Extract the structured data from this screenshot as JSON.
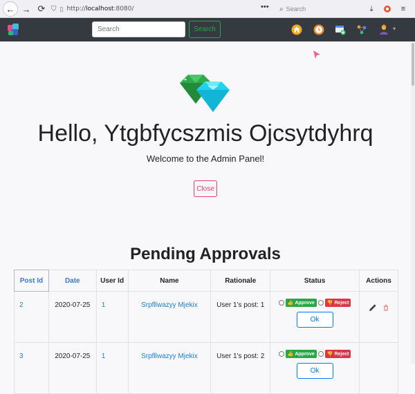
{
  "browser": {
    "url_prefix": "http://",
    "url_host": "localhost",
    "url_rest": ":8080/",
    "search_placeholder": "Search",
    "menu_dots": "•••"
  },
  "navbar": {
    "search_placeholder": "Search",
    "search_button": "Search",
    "icons": [
      "home-icon",
      "clock-icon",
      "add-window-icon",
      "network-icon",
      "user-avatar-icon"
    ]
  },
  "hero": {
    "title": "Hello, Ytgbfycszmis Ojcsytdyhrq",
    "subtitle": "Welcome to the Admin Panel!",
    "close_button": "Close"
  },
  "approvals": {
    "title": "Pending Approvals",
    "columns": [
      "Post Id",
      "Date",
      "User Id",
      "Name",
      "Rationale",
      "Status",
      "Actions"
    ],
    "rows": [
      {
        "post_id": "2",
        "date": "2020-07-25",
        "user_id": "1",
        "name": "Srpfllwazyy Mjekix",
        "rationale": "User 1's post: 1",
        "approve": "Approve",
        "reject": "Reject",
        "ok": "Ok"
      },
      {
        "post_id": "3",
        "date": "2020-07-25",
        "user_id": "1",
        "name": "Srpfllwazyy Mjekix",
        "rationale": "User 1's post: 2",
        "approve": "Approve",
        "reject": "Reject",
        "ok": "Ok"
      }
    ]
  },
  "colors": {
    "navbar": "#343a40",
    "success": "#28a745",
    "danger": "#dc3545",
    "primary": "#007bff",
    "close": "#e83e6c"
  }
}
